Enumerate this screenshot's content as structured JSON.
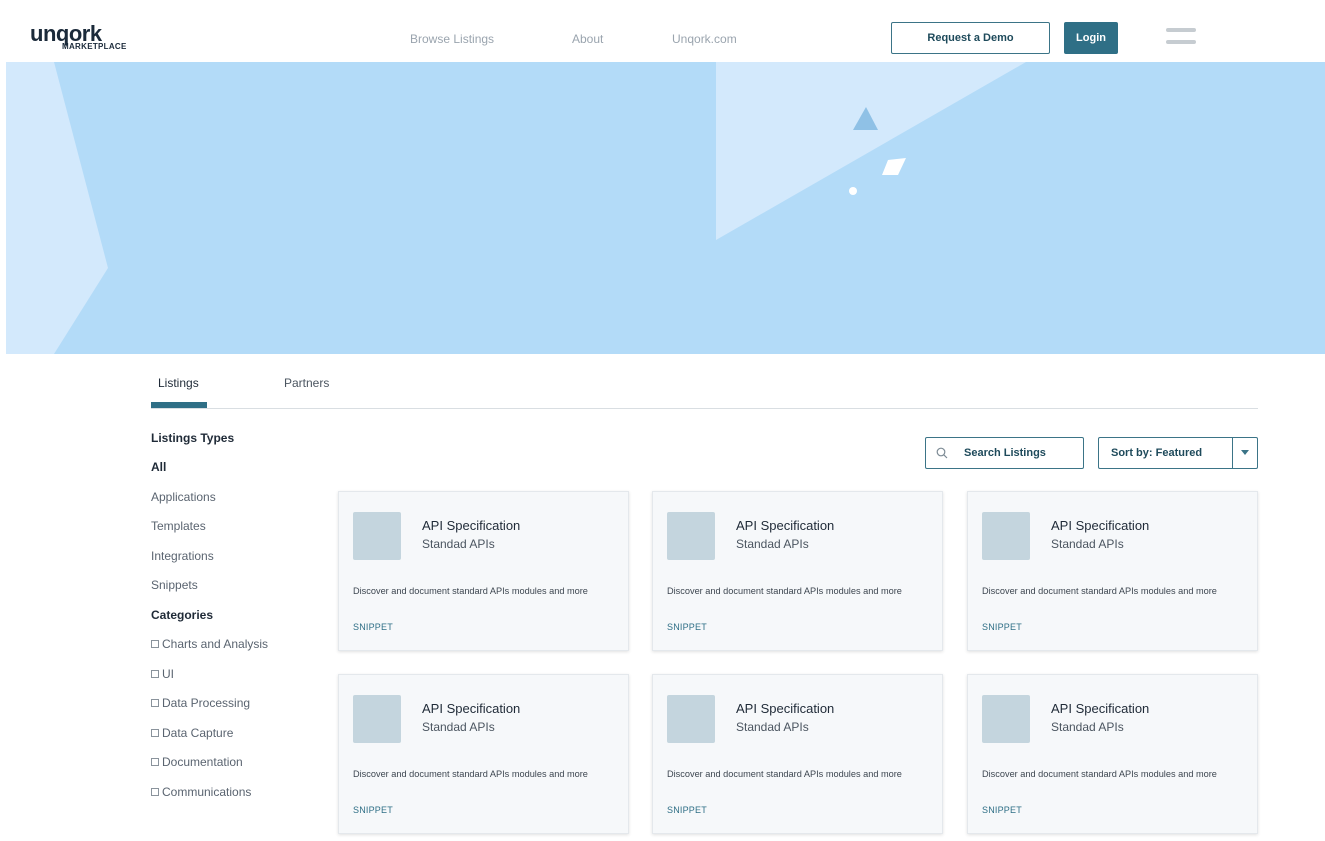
{
  "header": {
    "logo_word": "unqork",
    "logo_sub": "MARKETPLACE",
    "nav": [
      "Browse Listings",
      "About",
      "Unqork.com"
    ],
    "demo_label": "Request a Demo",
    "login_label": "Login"
  },
  "tabs": [
    "Listings",
    "Partners"
  ],
  "sidebar": {
    "types_heading": "Listings Types",
    "types": [
      "All",
      "Applications",
      "Templates",
      "Integrations",
      "Snippets"
    ],
    "categories_heading": "Categories",
    "categories": [
      "Charts and Analysis",
      "UI",
      "Data Processing",
      "Data Capture",
      "Documentation",
      "Communications"
    ]
  },
  "toolbar": {
    "search_placeholder": "Search Listings",
    "sort_label": "Sort by: Featured"
  },
  "cards": [
    {
      "title": "API Specification",
      "subtitle": "Standad APIs",
      "description": "Discover and document standard APIs modules and more",
      "tag": "SNIPPET"
    },
    {
      "title": "API Specification",
      "subtitle": "Standad APIs",
      "description": "Discover and document standard APIs modules and more",
      "tag": "SNIPPET"
    },
    {
      "title": "API Specification",
      "subtitle": "Standad APIs",
      "description": "Discover and document standard APIs modules and more",
      "tag": "SNIPPET"
    },
    {
      "title": "API Specification",
      "subtitle": "Standad APIs",
      "description": "Discover and document standard APIs modules and more",
      "tag": "SNIPPET"
    },
    {
      "title": "API Specification",
      "subtitle": "Standad APIs",
      "description": "Discover and document standard APIs modules and more",
      "tag": "SNIPPET"
    },
    {
      "title": "API Specification",
      "subtitle": "Standad APIs",
      "description": "Discover and document standard APIs modules and more",
      "tag": "SNIPPET"
    }
  ],
  "colors": {
    "accent": "#2f6f86",
    "hero": "#b3dbf8",
    "card_bg": "#f6f8fa"
  }
}
